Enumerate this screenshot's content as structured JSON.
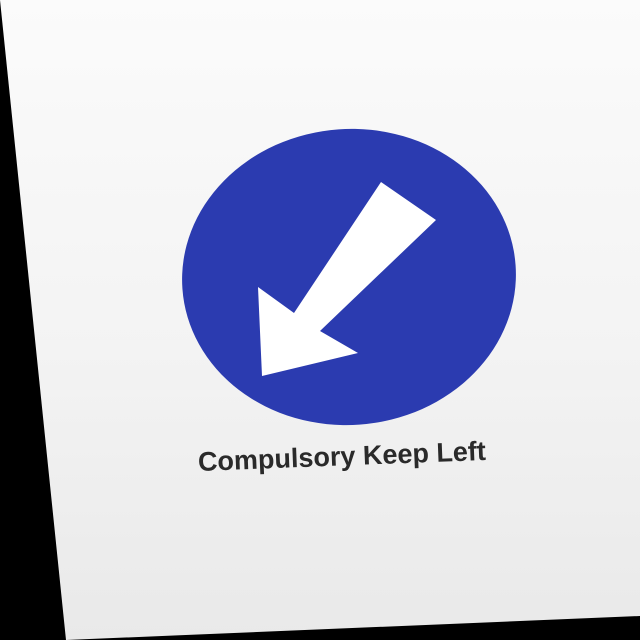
{
  "sign": {
    "caption": "Compulsory Keep Left",
    "icon": "down-left-arrow-icon",
    "circle_color": "#2b3bb0",
    "arrow_color": "#ffffff"
  }
}
